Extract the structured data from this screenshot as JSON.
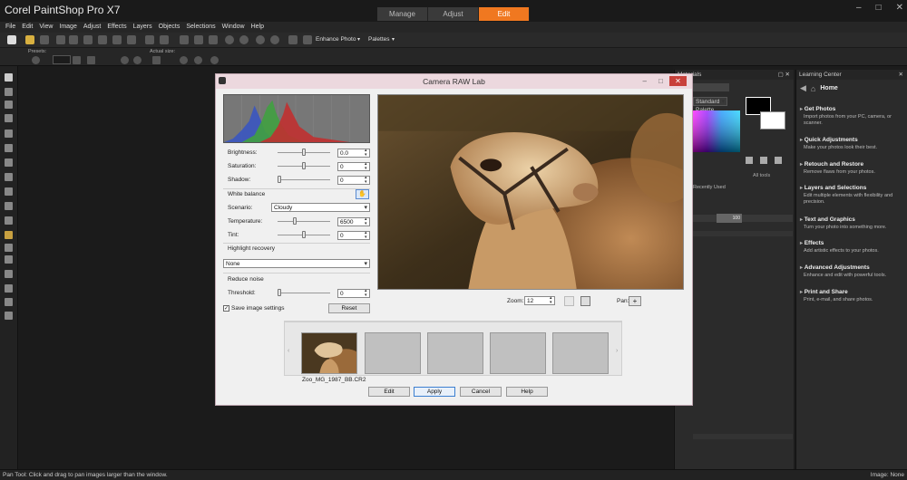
{
  "app": {
    "title": "Corel PaintShop Pro X7",
    "workspace_tabs": [
      {
        "label": "Manage",
        "active": false
      },
      {
        "label": "Adjust",
        "active": false
      },
      {
        "label": "Edit",
        "active": true
      }
    ],
    "accent_color": "#f07820"
  },
  "menu": [
    "File",
    "Edit",
    "View",
    "Image",
    "Adjust",
    "Effects",
    "Layers",
    "Objects",
    "Selections",
    "Window",
    "Help"
  ],
  "toolbar": {
    "enhance_photo": "Enhance Photo",
    "palettes": "Palettes"
  },
  "options_bar": {
    "presets_label": "Presets:",
    "actual_size_label": "Actual size:"
  },
  "materials": {
    "title": "Materials",
    "palette_select": "Standard Palette",
    "recently_used": "Recently Used",
    "all_tools": "All tools",
    "layers_opacity": "100"
  },
  "learning_center": {
    "title": "Learning Center",
    "home": "Home",
    "sections": [
      {
        "title": "Get Photos",
        "desc": "Import photos from your PC, camera, or scanner."
      },
      {
        "title": "Quick Adjustments",
        "desc": "Make your photos look their best."
      },
      {
        "title": "Retouch and Restore",
        "desc": "Remove flaws from your photos."
      },
      {
        "title": "Layers and Selections",
        "desc": "Edit multiple elements with flexibility and precision."
      },
      {
        "title": "Text and Graphics",
        "desc": "Turn your photo into something more."
      },
      {
        "title": "Effects",
        "desc": "Add artistic effects to your photos."
      },
      {
        "title": "Advanced Adjustments",
        "desc": "Enhance and edit with powerful tools."
      },
      {
        "title": "Print and Share",
        "desc": "Print, e-mail, and share photos."
      }
    ]
  },
  "status": {
    "left": "Pan Tool: Click and drag to pan images larger than the window.",
    "right": "Image: None"
  },
  "dialog": {
    "title": "Camera RAW Lab",
    "brightness_label": "Brightness:",
    "brightness_value": "0.0",
    "saturation_label": "Saturation:",
    "saturation_value": "0",
    "shadow_label": "Shadow:",
    "shadow_value": "0",
    "white_balance_label": "White balance",
    "scenario_label": "Scenario:",
    "scenario_value": "Cloudy",
    "temperature_label": "Temperature:",
    "temperature_value": "6500",
    "tint_label": "Tint:",
    "tint_value": "0",
    "highlight_recovery_label": "Highlight recovery",
    "highlight_recovery_value": "None",
    "reduce_noise_label": "Reduce noise",
    "threshold_label": "Threshold:",
    "threshold_value": "0",
    "save_settings_label": "Save image settings",
    "reset_label": "Reset",
    "zoom_label": "Zoom:",
    "zoom_value": "12",
    "pan_label": "Pan:",
    "thumbnail_caption": "Zoo_MG_1987_BB.CR2",
    "buttons": {
      "edit": "Edit",
      "apply": "Apply",
      "cancel": "Cancel",
      "help": "Help"
    }
  }
}
